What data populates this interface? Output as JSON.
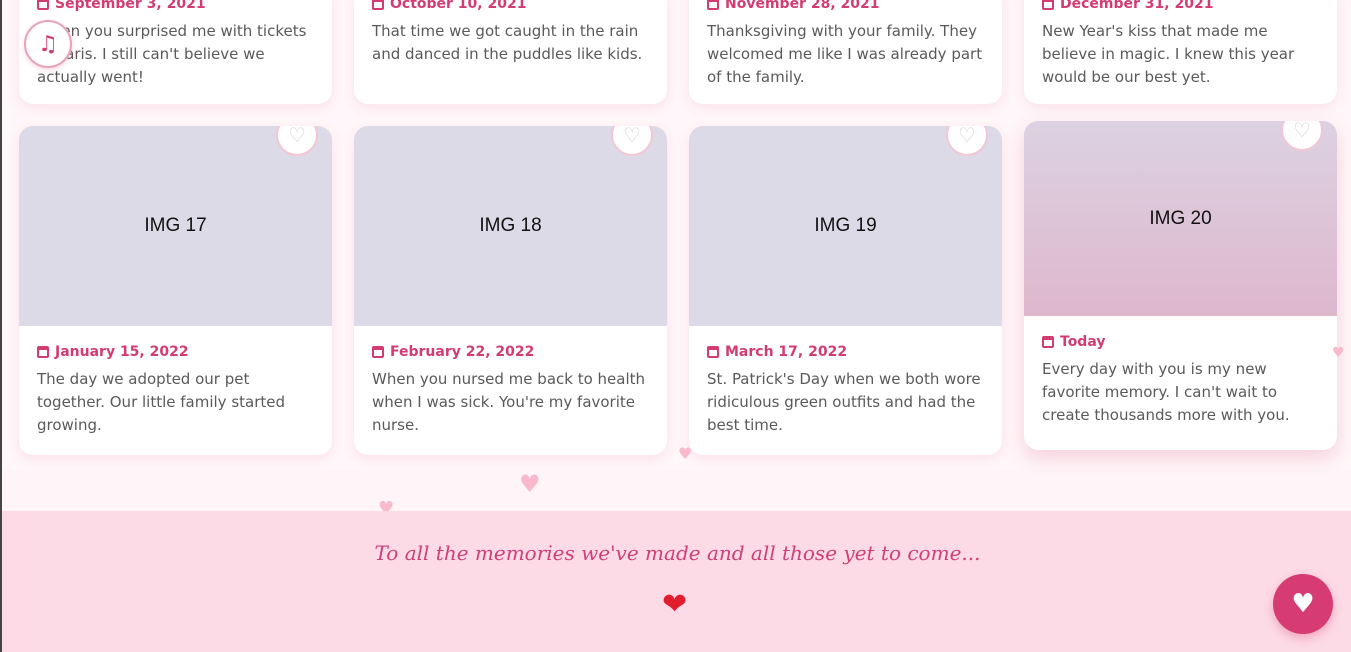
{
  "top_cards": [
    {
      "date": "September 3, 2021",
      "text": "When you surprised me with tickets to Paris. I still can't believe we actually went!"
    },
    {
      "date": "October 10, 2021",
      "text": "That time we got caught in the rain and danced in the puddles like kids."
    },
    {
      "date": "November 28, 2021",
      "text": "Thanksgiving with your family. They welcomed me like I was already part of the family."
    },
    {
      "date": "December 31, 2021",
      "text": "New Year's kiss that made me believe in magic. I knew this year would be our best yet."
    }
  ],
  "cards": [
    {
      "image_label": "IMG 17",
      "date": "January 15, 2022",
      "text": "The day we adopted our pet together. Our little family started growing."
    },
    {
      "image_label": "IMG 18",
      "date": "February 22, 2022",
      "text": "When you nursed me back to health when I was sick. You're my favorite nurse."
    },
    {
      "image_label": "IMG 19",
      "date": "March 17, 2022",
      "text": "St. Patrick's Day when we both wore ridiculous green outfits and had the best time."
    },
    {
      "image_label": "IMG 20",
      "date": "Today",
      "text": "Every day with you is my new favorite memory. I can't wait to create thousands more with you."
    }
  ],
  "footer": {
    "message": "To all the memories we've made and all those yet to come..."
  },
  "icons": {
    "music": "music-note-icon",
    "like": "heart-outline-icon",
    "calendar": "calendar-icon",
    "fab": "heart-filled-icon"
  },
  "colors": {
    "accent": "#d23c73",
    "footer_bg": "#fddbe6",
    "photo_placeholder": "#dcdae6"
  }
}
